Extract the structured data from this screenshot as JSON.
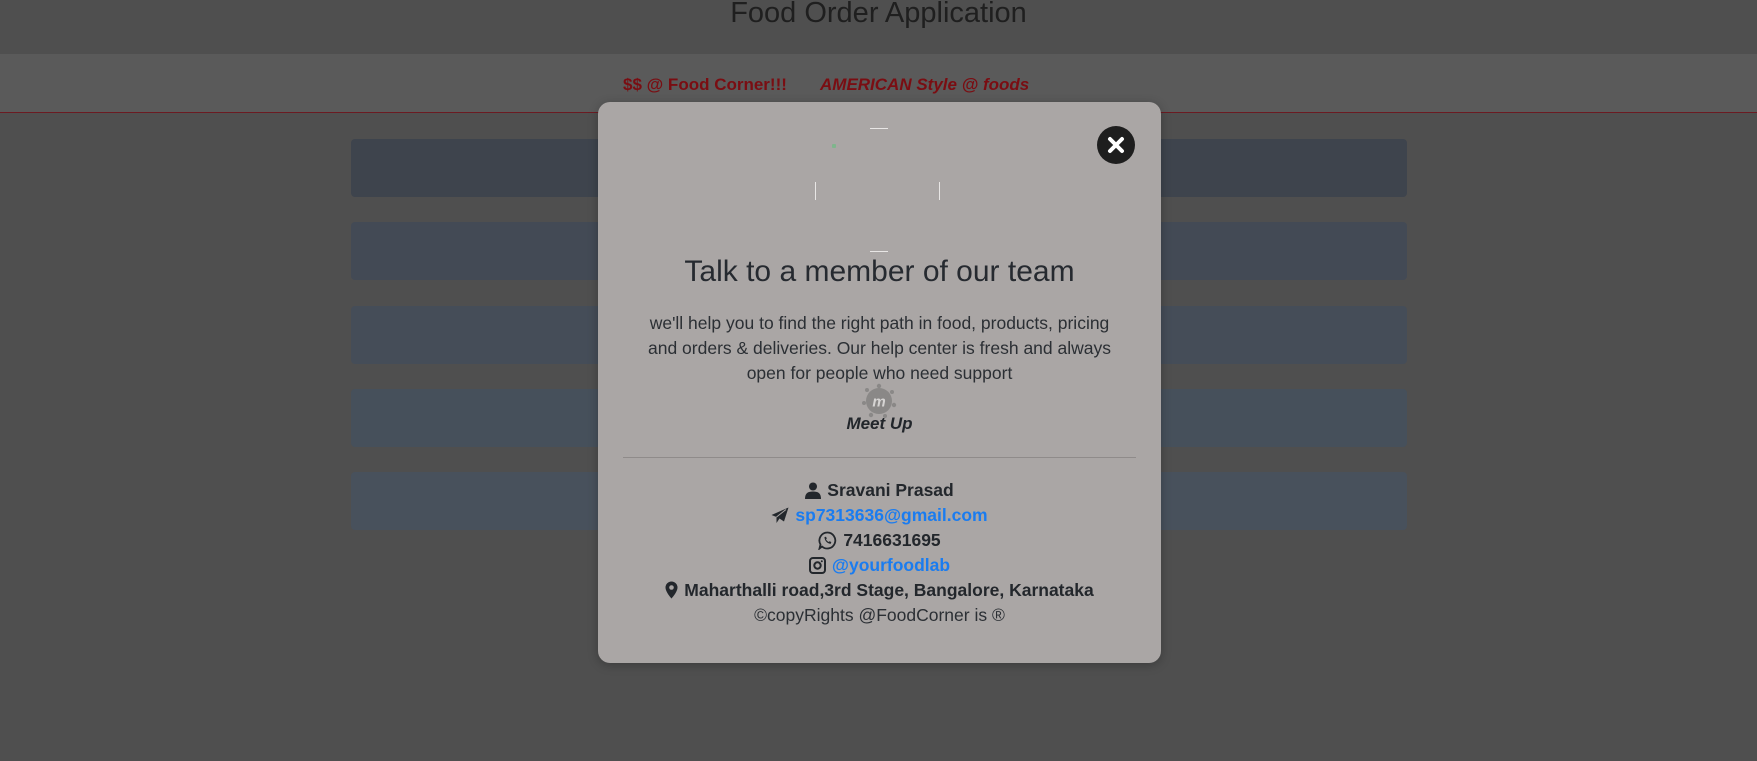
{
  "app": {
    "title": "Food Order Application"
  },
  "nav": {
    "items": [
      {
        "label": "$$ @ Food Corner!!!"
      },
      {
        "label": "AMERICAN Style @ foods"
      }
    ],
    "link_color": "#7a0d12"
  },
  "modal": {
    "close_icon": "close-icon",
    "heading": "Talk to a member of our team",
    "description": "we'll help you to find the right path in food, products, pricing and orders & deliveries. Our help center is fresh and always open for people who need support",
    "meetup": {
      "icon": "meetup-icon",
      "label": "Meet Up"
    },
    "contact": {
      "name": "Sravani Prasad",
      "name_icon": "user-icon",
      "email": "sp7313636@gmail.com",
      "email_icon": "paper-plane-icon",
      "phone": "7416631695",
      "phone_icon": "whatsapp-icon",
      "instagram": "@yourfoodlab",
      "instagram_icon": "instagram-icon",
      "address": "Maharthalli road,3rd Stage, Bangalore, Karnataka",
      "address_icon": "map-marker-icon",
      "copyright": "©copyRights @FoodCorner is ®"
    },
    "link_color": "#1a7cf0"
  }
}
